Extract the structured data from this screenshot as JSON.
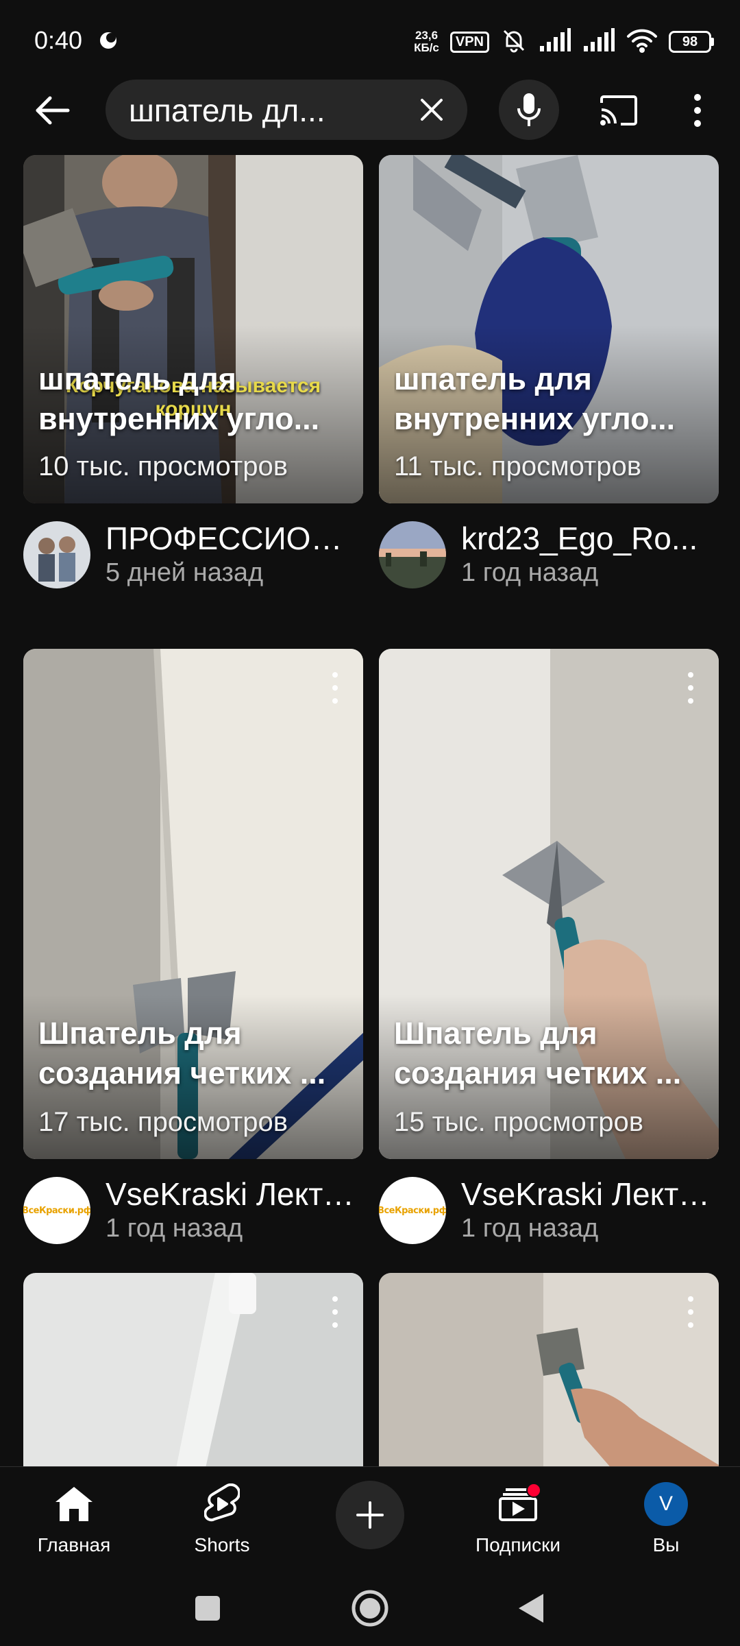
{
  "status_bar": {
    "time": "0:40",
    "net_speed_value": "23,6",
    "net_speed_unit": "КБ/с",
    "vpn": "VPN",
    "battery": "98"
  },
  "search": {
    "query": "шпатель дл..."
  },
  "videos": [
    {
      "title_line1": "шпатель для",
      "title_line2": "внутренних угло...",
      "views": "10 тыс. просмотров",
      "channel": "ПРОФЕССИОНАЛЫ",
      "age": "5 дней назад",
      "overlay_caption_1": "Корчуганова  называется",
      "overlay_caption_2": "коршун"
    },
    {
      "title_line1": "шпатель для",
      "title_line2": "внутренних угло...",
      "views": "11 тыс. просмотров",
      "channel": "krd23_Ego_Ro...",
      "age": "1 год назад"
    },
    {
      "title_line1": "Шпатель для",
      "title_line2": "создания четких ...",
      "views": "17 тыс. просмотров",
      "channel": "VseKraski Лекторий",
      "age": "1 год назад",
      "avatar_text": "ВсеКраски.рф"
    },
    {
      "title_line1": "Шпатель для",
      "title_line2": "создания четких ...",
      "views": "15 тыс. просмотров",
      "channel": "VseKraski Лекторий",
      "age": "1 год назад",
      "avatar_text": "ВсеКраски.рф"
    }
  ],
  "bottom_nav": {
    "home": "Главная",
    "shorts": "Shorts",
    "subscriptions": "Подписки",
    "you": "Вы",
    "you_initial": "V"
  },
  "colors": {
    "background": "#0f0f0f",
    "surface": "#272727",
    "notification": "#ff0033",
    "avatar": "#0b5ba8"
  }
}
